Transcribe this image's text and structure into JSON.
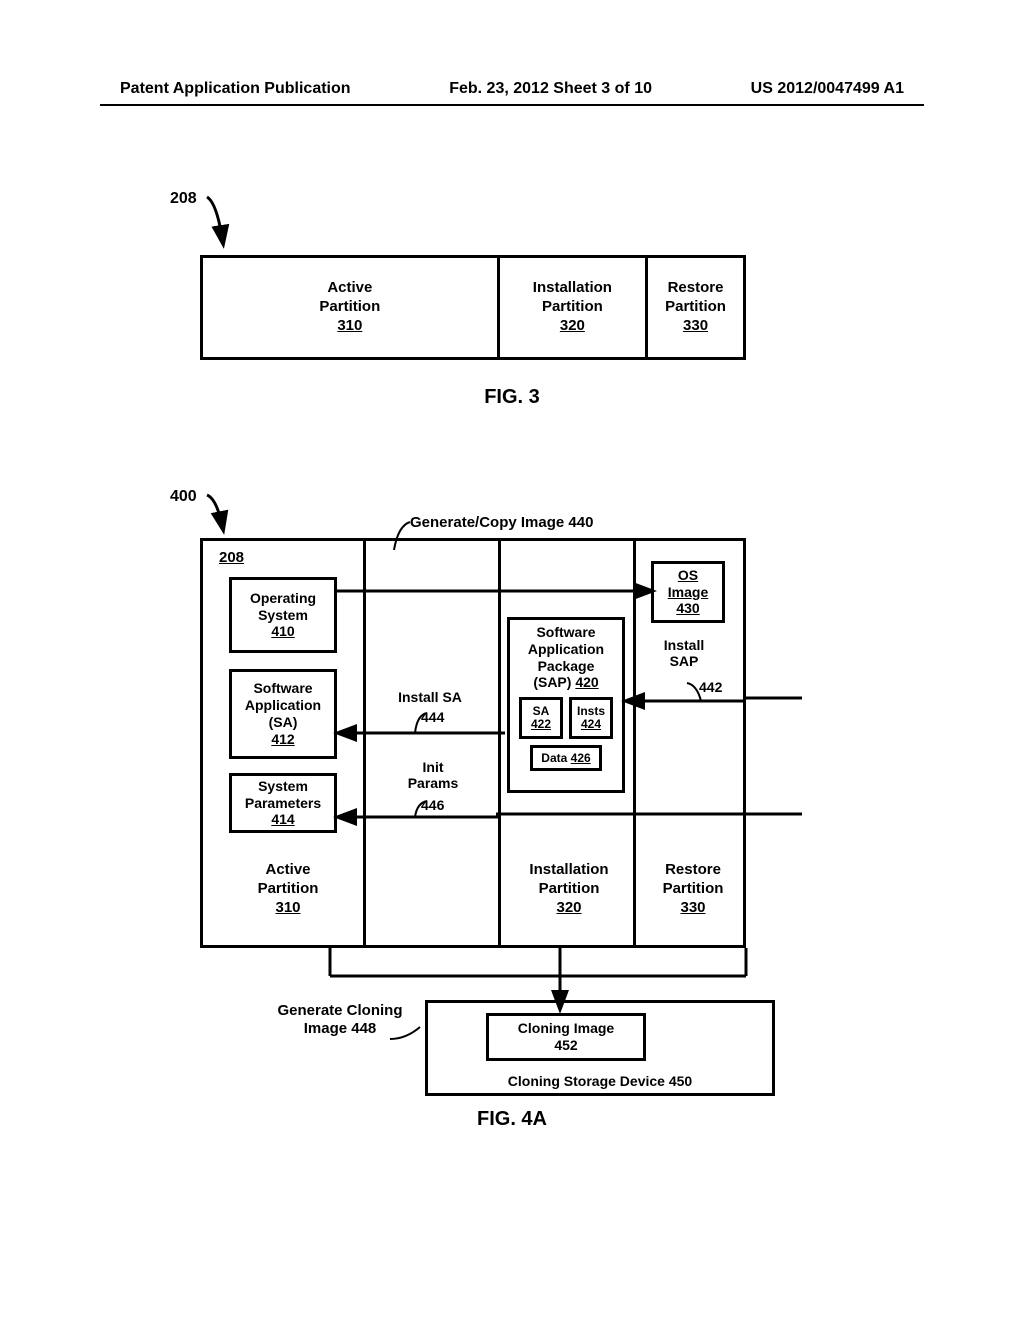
{
  "header": {
    "left": "Patent Application Publication",
    "center": "Feb. 23, 2012  Sheet 3 of 10",
    "right": "US 2012/0047499 A1"
  },
  "fig3": {
    "ref": "208",
    "active": {
      "l1": "Active",
      "l2": "Partition",
      "num": "310"
    },
    "install": {
      "l1": "Installation",
      "l2": "Partition",
      "num": "320"
    },
    "restore": {
      "l1": "Restore",
      "l2": "Partition",
      "num": "330"
    },
    "caption": "FIG. 3"
  },
  "fig4": {
    "ref": "400",
    "gencopy": "Generate/Copy Image 440",
    "ref208": "208",
    "os": {
      "l1": "Operating",
      "l2": "System",
      "num": "410"
    },
    "sa": {
      "l1": "Software",
      "l2": "Application",
      "l3": "(SA)",
      "num": "412"
    },
    "sp": {
      "l1": "System",
      "l2": "Parameters",
      "num": "414"
    },
    "sap": {
      "l1": "Software",
      "l2": "Application",
      "l3": "Package",
      "l4": "(SAP)",
      "num": "420"
    },
    "sa422": {
      "t": "SA",
      "n": "422"
    },
    "insts": {
      "t": "Insts",
      "n": "424"
    },
    "data": {
      "t": "Data",
      "n": "426"
    },
    "osimg": {
      "l1": "OS",
      "l2": "Image",
      "num": "430"
    },
    "installSA": {
      "t": "Install SA",
      "n": "444"
    },
    "init": {
      "t1": "Init",
      "t2": "Params",
      "n": "446"
    },
    "installSAP": {
      "t1": "Install",
      "t2": "SAP",
      "n": "442"
    },
    "ap": {
      "l1": "Active",
      "l2": "Partition",
      "num": "310"
    },
    "ip": {
      "l1": "Installation",
      "l2": "Partition",
      "num": "320"
    },
    "rp": {
      "l1": "Restore",
      "l2": "Partition",
      "num": "330"
    },
    "genclone": {
      "l1": "Generate Cloning",
      "l2": "Image 448"
    },
    "cloneimg": {
      "l1": "Cloning Image",
      "l2": "452"
    },
    "clonedev": "Cloning Storage Device 450",
    "caption": "FIG. 4A"
  }
}
